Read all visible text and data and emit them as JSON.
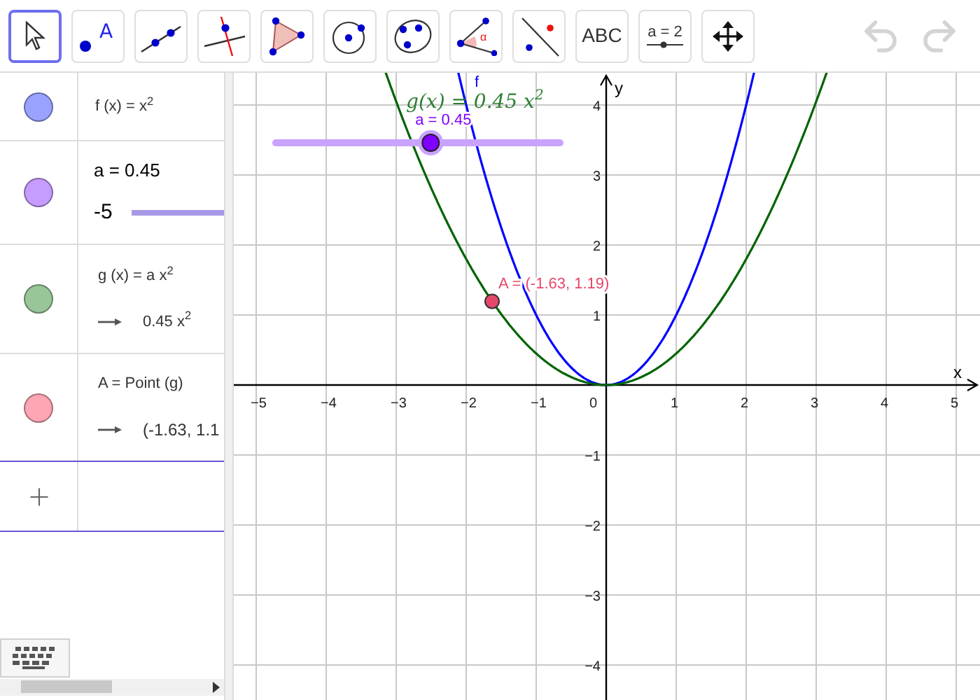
{
  "toolbar": {
    "tools": [
      {
        "kind": "move",
        "selected": true
      },
      {
        "kind": "point",
        "label": "A",
        "selected": false
      },
      {
        "kind": "line",
        "selected": false
      },
      {
        "kind": "perpendicular",
        "selected": false
      },
      {
        "kind": "polygon",
        "selected": false
      },
      {
        "kind": "circle",
        "selected": false
      },
      {
        "kind": "conic",
        "selected": false
      },
      {
        "kind": "angle",
        "label": "α",
        "selected": false
      },
      {
        "kind": "reflect",
        "selected": false
      },
      {
        "kind": "text",
        "label": "ABC",
        "selected": false
      },
      {
        "kind": "slider",
        "label": "a = 2",
        "selected": false
      },
      {
        "kind": "pan",
        "selected": false
      }
    ],
    "undo": {
      "disabled": true
    },
    "redo": {
      "disabled": true
    }
  },
  "algebra": {
    "items": [
      {
        "kind": "function",
        "color": "#99a3ff",
        "definition": "f (x) = x$^{2}$"
      },
      {
        "kind": "slider",
        "color": "#c79cff",
        "definition": "a = 0.45",
        "min": "-5"
      },
      {
        "kind": "dependent",
        "color": "#99c699",
        "definition": "g (x) = a x$^{2}$",
        "value": "0.45 x$^{2}$"
      },
      {
        "kind": "dependent",
        "color": "#ffa6b5",
        "definition": "A = Point (g)",
        "value": "(-1.63, 1.1"
      }
    ]
  },
  "graphics": {
    "x_axis_label": "x",
    "y_axis_label": "y",
    "x_ticks": [
      "−5",
      "−4",
      "−3",
      "−2",
      "−1",
      "0",
      "1",
      "2",
      "3",
      "4",
      "5"
    ],
    "y_ticks": [
      "4",
      "3",
      "2",
      "1",
      "−1",
      "−2",
      "−3",
      "−4"
    ],
    "g_label": "g(x)  = 0.45 x$^{2}$",
    "f_label": "f",
    "slider": {
      "label": "a = 0.45",
      "level": 0.545
    },
    "point": {
      "label": "A = (-1.63, 1.19)"
    }
  }
}
